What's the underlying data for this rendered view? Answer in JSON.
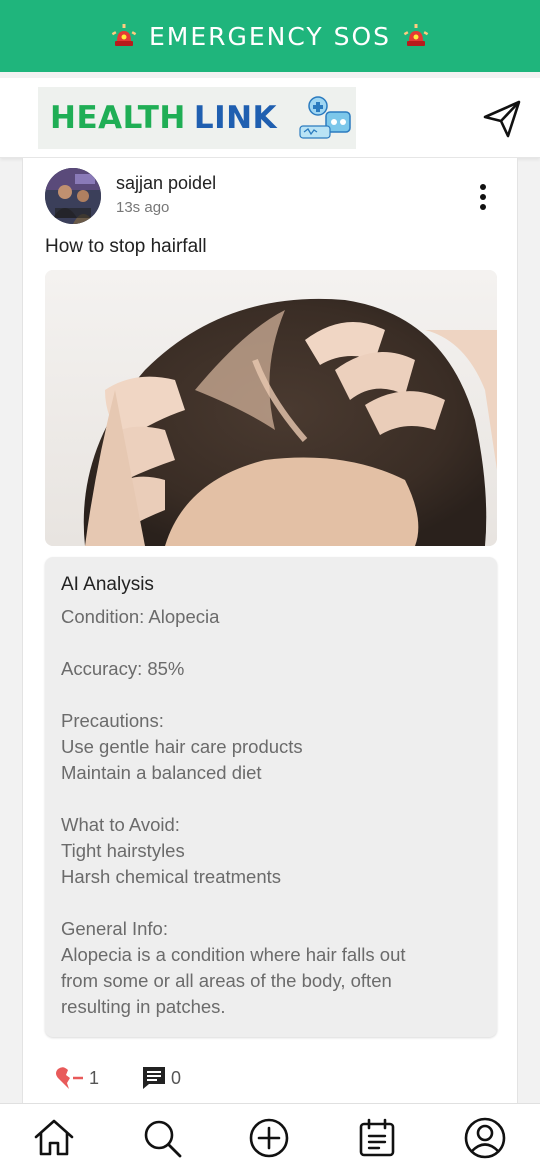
{
  "sos_bar": {
    "label": "EMERGENCY SOS",
    "color": "#1fb57c"
  },
  "header": {
    "logo_word1": "HEALTH",
    "logo_word2": "LINK",
    "send_icon": "send-icon"
  },
  "post": {
    "username": "sajjan poidel",
    "time": "13s ago",
    "text": "How to stop hairfall",
    "image_alt": "woman parting hair showing hair loss",
    "analysis": {
      "title": "AI Analysis",
      "condition": "Condition: Alopecia",
      "accuracy": "Accuracy: 85%",
      "precautions_heading": "Precautions:",
      "precautions": [
        "Use gentle hair care products",
        "Maintain a balanced diet"
      ],
      "avoid_heading": "What to Avoid:",
      "avoid": [
        "Tight hairstyles",
        "Harsh chemical treatments"
      ],
      "info_heading": "General Info:",
      "info_lines": [
        "Alopecia is a condition where hair falls out",
        "from some or all areas of the body, often",
        "resulting in patches."
      ]
    },
    "likes": "1",
    "comments": "0"
  },
  "nav": {
    "items": [
      {
        "icon": "home-icon"
      },
      {
        "icon": "search-icon"
      },
      {
        "icon": "add-post-icon"
      },
      {
        "icon": "calendar-icon"
      },
      {
        "icon": "profile-icon"
      }
    ]
  }
}
